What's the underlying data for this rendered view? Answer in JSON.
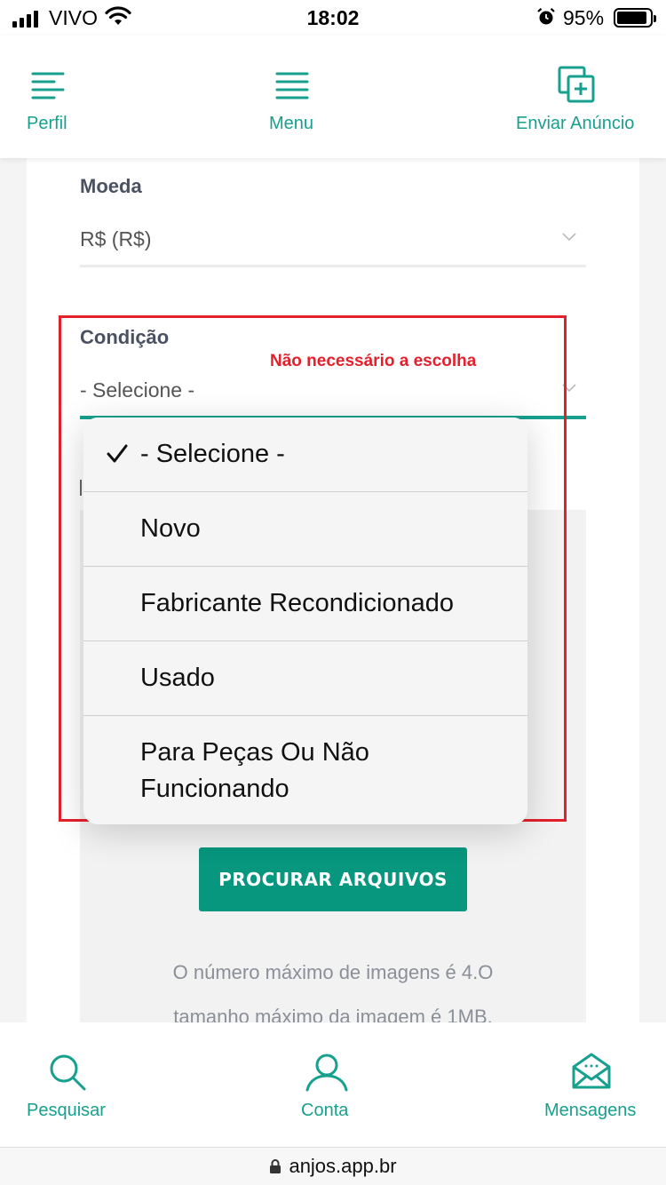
{
  "status": {
    "carrier": "VIVO",
    "time": "18:02",
    "battery": "95%"
  },
  "top_nav": {
    "profile": "Perfil",
    "menu": "Menu",
    "post_ad": "Enviar Anúncio"
  },
  "form": {
    "currency_label": "Moeda",
    "currency_value": "R$ (R$)",
    "condition_label": "Condição",
    "condition_value": "- Selecione -"
  },
  "annotation": "Não necessário a escolha",
  "dropdown": {
    "selected_index": 0,
    "options": [
      "- Selecione -",
      "Novo",
      "Fabricante Recondicionado",
      "Usado",
      "Para Peças Ou Não Funcionando"
    ]
  },
  "upload": {
    "button_label": "PROCURAR ARQUIVOS",
    "help": "O número máximo de imagens é 4.O tamanho máximo da imagem é 1MB."
  },
  "bottom_nav": {
    "search": "Pesquisar",
    "account": "Conta",
    "messages": "Mensagens"
  },
  "url": "anjos.app.br",
  "colors": {
    "accent": "#17a08d",
    "button": "#07967e",
    "annotation": "#e3202c"
  }
}
